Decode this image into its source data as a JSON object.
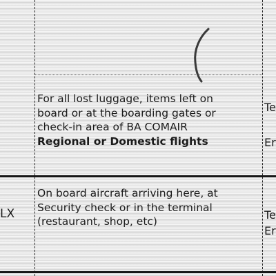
{
  "rows": [
    {
      "description_lines": [
        "For all lost luggage, items left on",
        "board or at the boarding gates or",
        "check-in area of BA COMAIR"
      ],
      "description_bold_line": "Regional or Domestic flights",
      "right_fragments": [
        "Te",
        "Er"
      ]
    },
    {
      "left_fragment": "LX",
      "description_lines": [
        "On board aircraft arriving here, at",
        "Security check or in the terminal",
        "(restaurant, shop, etc)"
      ],
      "right_fragments": [
        "Te",
        "Er"
      ]
    }
  ],
  "colors": {
    "paper": "#e7e7e7",
    "ink": "#1b1b1b",
    "pen": "#3a3a3a"
  }
}
